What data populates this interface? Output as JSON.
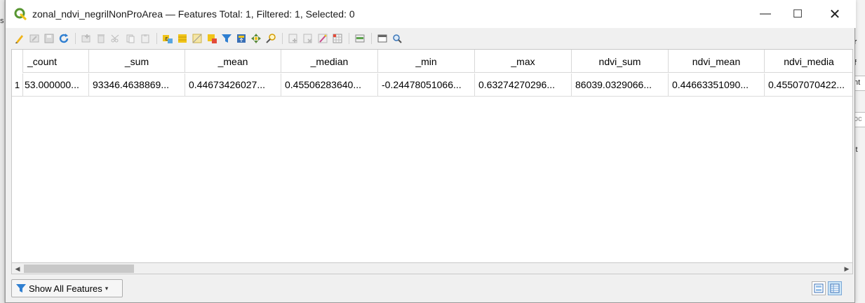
{
  "window": {
    "title": "zonal_ndvi_negrilNonProArea — Features Total: 1, Filtered: 1, Selected: 0",
    "minimize": "—",
    "maximize": "☐",
    "close": "✕"
  },
  "background": {
    "left_label": "s",
    "right_frags": [
      "r",
      "f",
      "nt",
      "oc",
      "lt"
    ]
  },
  "toolbar": {
    "icons": [
      "edit-pencil-icon",
      "multi-edit-icon",
      "save-edits-icon",
      "reload-icon",
      "add-feature-icon",
      "delete-feature-icon",
      "cut-icon",
      "copy-icon",
      "paste-icon",
      "select-by-expression-icon",
      "select-all-icon",
      "invert-selection-icon",
      "deselect-all-icon",
      "filter-selected-icon",
      "move-selection-top-icon",
      "pan-to-selected-icon",
      "zoom-to-selected-icon",
      "new-field-icon",
      "delete-field-icon",
      "field-calculator-icon",
      "conditional-formatting-icon",
      "actions-icon",
      "dock-icon",
      "help-icon"
    ]
  },
  "table": {
    "columns": [
      "_count",
      "_sum",
      "_mean",
      "_median",
      "_min",
      "_max",
      "ndvi_sum",
      "ndvi_mean",
      "ndvi_media"
    ],
    "rows": [
      {
        "num": "1",
        "cells": [
          "53.000000...",
          "93346.4638869...",
          "0.44673426027...",
          "0.45506283640...",
          "-0.24478051066...",
          "0.63274270296...",
          "86039.0329066...",
          "0.44663351090...",
          "0.45507070422..."
        ]
      }
    ]
  },
  "bottom": {
    "filter_label": "Show All Features",
    "dropdown_glyph": "▾"
  },
  "colors": {
    "qgis_green": "#589632",
    "qgis_yellow": "#f0c419",
    "filter_blue": "#2f7fd1"
  }
}
